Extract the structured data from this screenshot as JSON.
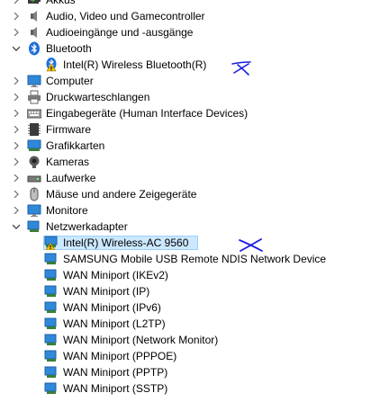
{
  "tree": {
    "categories": [
      {
        "label": "Akkus",
        "icon": "battery-icon",
        "expanded": false
      },
      {
        "label": "Audio, Video und Gamecontroller",
        "icon": "speaker-icon",
        "expanded": false
      },
      {
        "label": "Audioeingänge und -ausgänge",
        "icon": "speaker-icon",
        "expanded": false
      },
      {
        "label": "Bluetooth",
        "icon": "bluetooth-icon",
        "expanded": true,
        "children": [
          {
            "label": "Intel(R) Wireless Bluetooth(R)",
            "icon": "bluetooth-warning-icon"
          }
        ]
      },
      {
        "label": "Computer",
        "icon": "monitor-icon",
        "expanded": false
      },
      {
        "label": "Druckwarteschlangen",
        "icon": "printer-icon",
        "expanded": false
      },
      {
        "label": "Eingabegeräte (Human Interface Devices)",
        "icon": "keyboard-icon",
        "expanded": false
      },
      {
        "label": "Firmware",
        "icon": "chip-icon",
        "expanded": false
      },
      {
        "label": "Grafikkarten",
        "icon": "display-adapter-icon",
        "expanded": false
      },
      {
        "label": "Kameras",
        "icon": "camera-icon",
        "expanded": false
      },
      {
        "label": "Laufwerke",
        "icon": "disk-drive-icon",
        "expanded": false
      },
      {
        "label": "Mäuse und andere Zeigegeräte",
        "icon": "mouse-icon",
        "expanded": false
      },
      {
        "label": "Monitore",
        "icon": "monitor-icon",
        "expanded": false
      },
      {
        "label": "Netzwerkadapter",
        "icon": "network-adapter-icon",
        "expanded": true,
        "children": [
          {
            "label": "Intel(R) Wireless-AC 9560",
            "icon": "network-warning-icon",
            "selected": true
          },
          {
            "label": "SAMSUNG Mobile USB Remote NDIS Network Device",
            "icon": "network-adapter-icon"
          },
          {
            "label": "WAN Miniport (IKEv2)",
            "icon": "network-adapter-icon"
          },
          {
            "label": "WAN Miniport (IP)",
            "icon": "network-adapter-icon"
          },
          {
            "label": "WAN Miniport (IPv6)",
            "icon": "network-adapter-icon"
          },
          {
            "label": "WAN Miniport (L2TP)",
            "icon": "network-adapter-icon"
          },
          {
            "label": "WAN Miniport (Network Monitor)",
            "icon": "network-adapter-icon"
          },
          {
            "label": "WAN Miniport (PPPOE)",
            "icon": "network-adapter-icon"
          },
          {
            "label": "WAN Miniport (PPTP)",
            "icon": "network-adapter-icon"
          },
          {
            "label": "WAN Miniport (SSTP)",
            "icon": "network-adapter-icon"
          }
        ]
      }
    ]
  },
  "colors": {
    "selection_fill": "#cce8ff",
    "selection_border": "#99d1ff",
    "annotation_ink": "#1a1ae6",
    "chevron": "#6b6b6b"
  }
}
